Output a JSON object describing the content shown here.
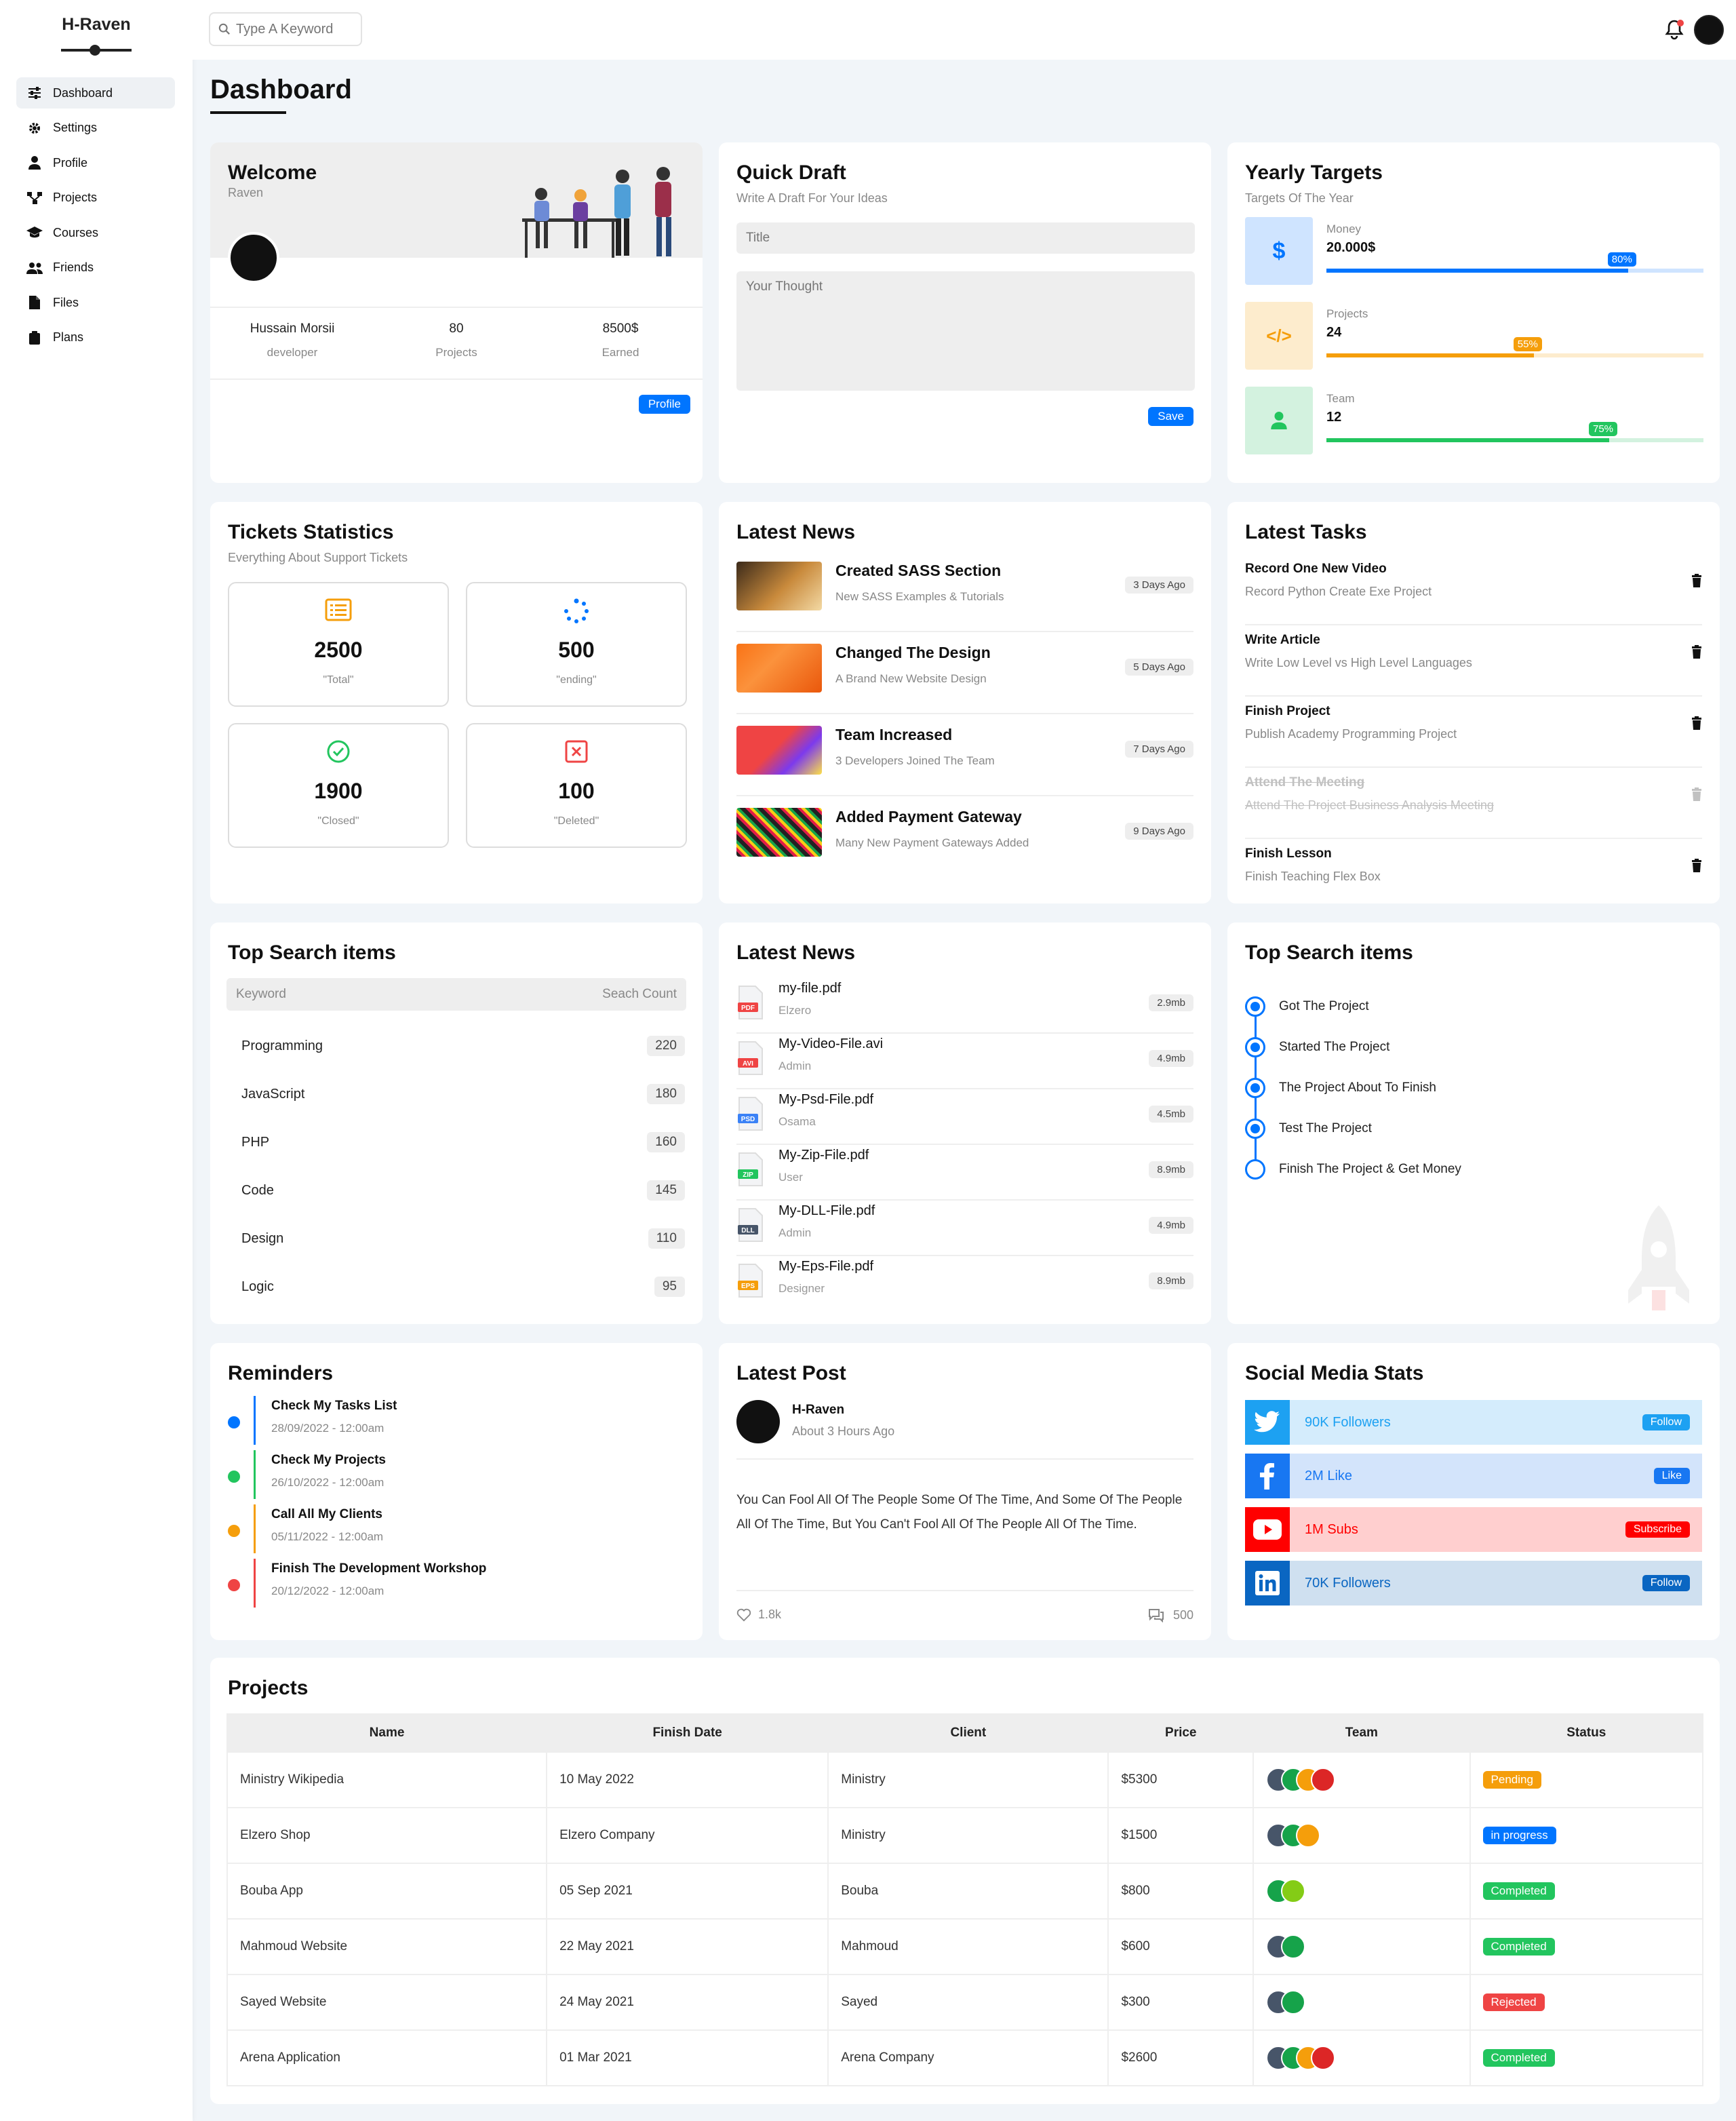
{
  "brand": "H-Raven",
  "sidebar": {
    "items": [
      {
        "label": "Dashboard",
        "icon": "sliders-icon"
      },
      {
        "label": "Settings",
        "icon": "gear-icon"
      },
      {
        "label": "Profile",
        "icon": "user-icon"
      },
      {
        "label": "Projects",
        "icon": "diagram-icon"
      },
      {
        "label": "Courses",
        "icon": "graduation-cap-icon"
      },
      {
        "label": "Friends",
        "icon": "users-icon"
      },
      {
        "label": "Files",
        "icon": "file-icon"
      },
      {
        "label": "Plans",
        "icon": "plan-icon"
      }
    ]
  },
  "header": {
    "search_placeholder": "Type A Keyword"
  },
  "page_title": "Dashboard",
  "welcome": {
    "title": "Welcome",
    "sub": "Raven",
    "name": "Hussain Morsii",
    "role": "developer",
    "projects": "80",
    "projects_label": "Projects",
    "earned": "8500$",
    "earned_label": "Earned",
    "button": "Profile"
  },
  "draft": {
    "title": "Quick Draft",
    "sub": "Write A Draft For Your Ideas",
    "title_placeholder": "Title",
    "body_placeholder": "Your Thought",
    "button": "Save"
  },
  "targets": {
    "title": "Yearly Targets",
    "sub": "Targets Of The Year",
    "items": [
      {
        "label": "Money",
        "value": "20.000$",
        "percent": 80,
        "badge": "80%",
        "color": "#0075ff",
        "bg": "#cfe4ff",
        "icon": "$"
      },
      {
        "label": "Projects",
        "value": "24",
        "percent": 55,
        "badge": "55%",
        "color": "#f59e0b",
        "bg": "#fdeccd",
        "icon": "</>"
      },
      {
        "label": "Team",
        "value": "12",
        "percent": 75,
        "badge": "75%",
        "color": "#22c55e",
        "bg": "#d3f2df",
        "icon": "user"
      }
    ]
  },
  "tickets": {
    "title": "Tickets Statistics",
    "sub": "Everything About Support Tickets",
    "items": [
      {
        "value": "2500",
        "label": "Total"
      },
      {
        "value": "500",
        "label": "ending"
      },
      {
        "value": "1900",
        "label": "Closed"
      },
      {
        "value": "100",
        "label": "Deleted"
      }
    ]
  },
  "news": {
    "title": "Latest News",
    "items": [
      {
        "title": "Created SASS Section",
        "sub": "New SASS Examples & Tutorials",
        "age": "3 Days Ago"
      },
      {
        "title": "Changed The Design",
        "sub": "A Brand New Website Design",
        "age": "5 Days Ago"
      },
      {
        "title": "Team Increased",
        "sub": "3 Developers Joined The Team",
        "age": "7 Days Ago"
      },
      {
        "title": "Added Payment Gateway",
        "sub": "Many New Payment Gateways Added",
        "age": "9 Days Ago"
      }
    ]
  },
  "tasks": {
    "title": "Latest Tasks",
    "items": [
      {
        "title": "Record One New Video",
        "sub": "Record Python Create Exe Project"
      },
      {
        "title": "Write Article",
        "sub": "Write Low Level vs High Level Languages"
      },
      {
        "title": "Finish Project",
        "sub": "Publish Academy Programming Project"
      },
      {
        "title": "Attend The Meeting",
        "sub": "Attend The Project Business Analysis Meeting"
      },
      {
        "title": "Finish Lesson",
        "sub": "Finish Teaching Flex Box"
      }
    ]
  },
  "search_items": {
    "title": "Top Search items",
    "col_keyword": "Keyword",
    "col_count": "Seach Count",
    "rows": [
      {
        "k": "Programming",
        "c": "220"
      },
      {
        "k": "JavaScript",
        "c": "180"
      },
      {
        "k": "PHP",
        "c": "160"
      },
      {
        "k": "Code",
        "c": "145"
      },
      {
        "k": "Design",
        "c": "110"
      },
      {
        "k": "Logic",
        "c": "95"
      }
    ]
  },
  "files": {
    "title": "Latest News",
    "items": [
      {
        "name": "my-file.pdf",
        "by": "Elzero",
        "size": "2.9mb",
        "type": "PDF",
        "color": "#ef4444"
      },
      {
        "name": "My-Video-File.avi",
        "by": "Admin",
        "size": "4.9mb",
        "type": "AVI",
        "color": "#ef4444"
      },
      {
        "name": "My-Psd-File.pdf",
        "by": "Osama",
        "size": "4.5mb",
        "type": "PSD",
        "color": "#3b82f6"
      },
      {
        "name": "My-Zip-File.pdf",
        "by": "User",
        "size": "8.9mb",
        "type": "ZIP",
        "color": "#22c55e"
      },
      {
        "name": "My-DLL-File.pdf",
        "by": "Admin",
        "size": "4.9mb",
        "type": "DLL",
        "color": "#475569"
      },
      {
        "name": "My-Eps-File.pdf",
        "by": "Designer",
        "size": "8.9mb",
        "type": "EPS",
        "color": "#f59e0b"
      }
    ]
  },
  "timeline": {
    "title": "Top Search items",
    "items": [
      {
        "label": "Got The Project",
        "done": true
      },
      {
        "label": "Started The Project",
        "done": true
      },
      {
        "label": "The Project About To Finish",
        "done": true
      },
      {
        "label": "Test The Project",
        "done": true
      },
      {
        "label": "Finish The Project & Get Money",
        "done": false
      }
    ]
  },
  "reminders": {
    "title": "Reminders",
    "items": [
      {
        "title": "Check My Tasks List",
        "date": "28/09/2022 - 12:00am",
        "color": "#0075ff"
      },
      {
        "title": "Check My Projects",
        "date": "26/10/2022 - 12:00am",
        "color": "#22c55e"
      },
      {
        "title": "Call All My Clients",
        "date": "05/11/2022 - 12:00am",
        "color": "#f59e0b"
      },
      {
        "title": "Finish The Development Workshop",
        "date": "20/12/2022 - 12:00am",
        "color": "#ef4444"
      }
    ]
  },
  "post": {
    "title": "Latest Post",
    "author": "H-Raven",
    "time": "About 3 Hours Ago",
    "body": "You Can Fool All Of The People Some Of The Time, And Some Of The People All Of The Time, But You Can't Fool All Of The People All Of The Time.",
    "likes": "1.8k",
    "comments": "500"
  },
  "social": {
    "title": "Social Media Stats",
    "items": [
      {
        "text": "90K Followers",
        "btn": "Follow",
        "icon": "twitter-icon",
        "color": "#1da1f2",
        "bg": "#d4ecfc"
      },
      {
        "text": "2M Like",
        "btn": "Like",
        "icon": "facebook-icon",
        "color": "#1877f2",
        "bg": "#d3e4fb"
      },
      {
        "text": "1M Subs",
        "btn": "Subscribe",
        "icon": "youtube-icon",
        "color": "#ff0000",
        "bg": "#ffcfcf"
      },
      {
        "text": "70K Followers",
        "btn": "Follow",
        "icon": "linkedin-icon",
        "color": "#0a66c2",
        "bg": "#cfe0f0"
      }
    ]
  },
  "projects": {
    "title": "Projects",
    "columns": [
      "Name",
      "Finish Date",
      "Client",
      "Price",
      "Team",
      "Status"
    ],
    "rows": [
      {
        "name": "Ministry Wikipedia",
        "date": "10 May 2022",
        "client": "Ministry",
        "price": "$5300",
        "team": 4,
        "status": "Pending",
        "color": "#f59e0b"
      },
      {
        "name": "Elzero Shop",
        "date": "Elzero Company",
        "client": "Ministry",
        "price": "$1500",
        "team": 3,
        "status": "in progress",
        "color": "#0075ff"
      },
      {
        "name": "Bouba App",
        "date": "05 Sep 2021",
        "client": "Bouba",
        "price": "$800",
        "team": 2,
        "status": "Completed",
        "color": "#22c55e"
      },
      {
        "name": "Mahmoud Website",
        "date": "22 May 2021",
        "client": "Mahmoud",
        "price": "$600",
        "team": 2,
        "status": "Completed",
        "color": "#22c55e"
      },
      {
        "name": "Sayed Website",
        "date": "24 May 2021",
        "client": "Sayed",
        "price": "$300",
        "team": 2,
        "status": "Rejected",
        "color": "#ef4444"
      },
      {
        "name": "Arena Application",
        "date": "01 Mar 2021",
        "client": "Arena Company",
        "price": "$2600",
        "team": 4,
        "status": "Completed",
        "color": "#22c55e"
      }
    ]
  }
}
